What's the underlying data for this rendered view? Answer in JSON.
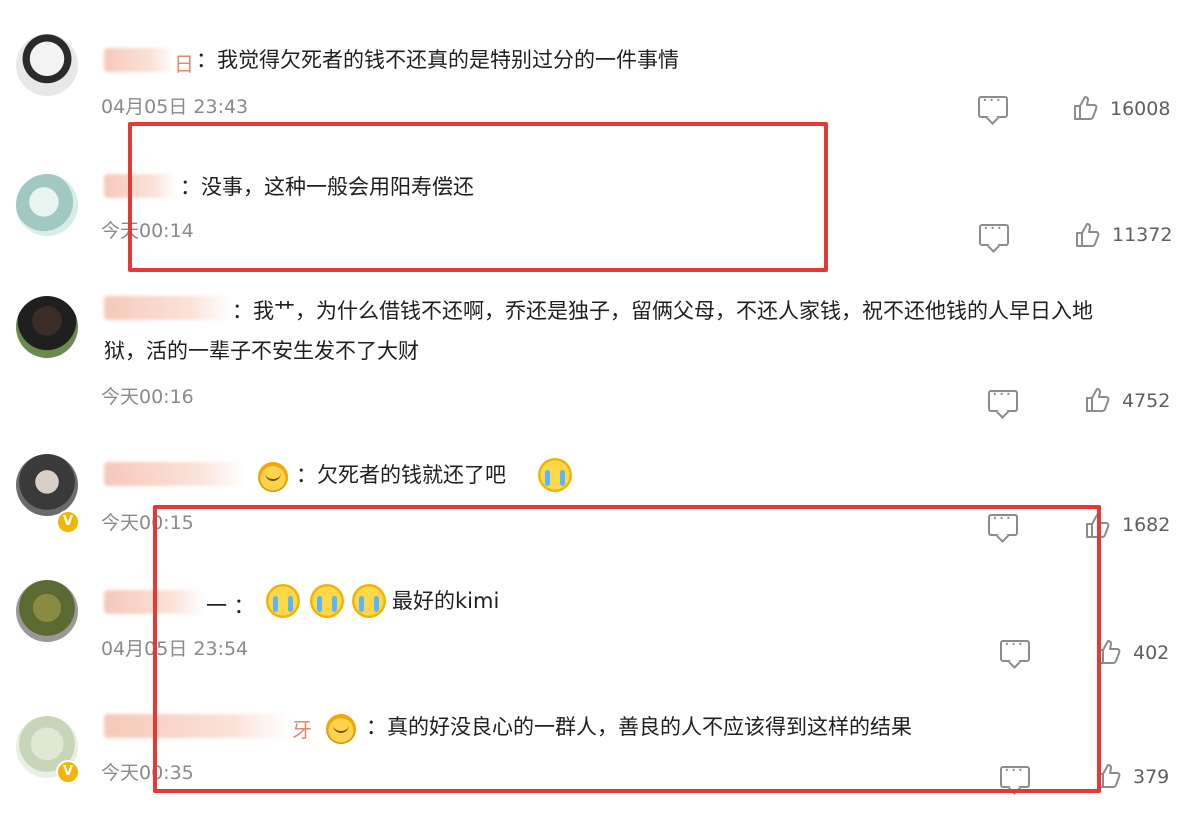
{
  "colors": {
    "highlight_box": "#e53935",
    "verified_badge": "#f5b400",
    "text": "#1f1f1f",
    "meta": "#8a8a8a"
  },
  "comments": [
    {
      "text": "：我觉得欠死者的钱不还真的是特别过分的一件事情",
      "username_partial": "日",
      "time": "04月05日 23:43",
      "likes": "16008",
      "comment_icon": "comment-icon",
      "like_icon": "thumbs-up-icon"
    },
    {
      "text": "：没事，这种一般会用阳寿偿还",
      "time": "今天00:14",
      "likes": "11372",
      "comment_icon": "comment-icon",
      "like_icon": "thumbs-up-icon"
    },
    {
      "text_line1": "：我艹，为什么借钱不还啊，乔还是独子，留俩父母，不还人家钱，祝不还他钱的人早日入地",
      "text_line2": "狱，活的一辈子不安生发不了大财",
      "time": "今天00:16",
      "likes": "4752",
      "comment_icon": "comment-icon",
      "like_icon": "thumbs-up-icon"
    },
    {
      "text": "：欠死者的钱就还了吧",
      "time": "今天00:15",
      "likes": "1682",
      "badge_icon": "fan-badge-emoji-icon",
      "trailing_icon": "crying-laughing-emoji-icon",
      "comment_icon": "comment-icon",
      "like_icon": "thumbs-up-icon",
      "verified": "V"
    },
    {
      "text": "最好的kimi",
      "username_partial": "一 ：",
      "time": "04月05日 23:54",
      "likes": "402",
      "emoji_icons": [
        "crying-emoji-icon",
        "crying-emoji-icon",
        "crying-emoji-icon"
      ],
      "comment_icon": "comment-icon",
      "like_icon": "thumbs-up-icon"
    },
    {
      "text": "：真的好没良心的一群人，善良的人不应该得到这样的结果",
      "username_partial": "牙",
      "time": "今天00:35",
      "likes": "379",
      "badge_icon": "fan-badge-emoji-icon",
      "comment_icon": "comment-icon",
      "like_icon": "thumbs-up-icon",
      "verified": "V"
    }
  ]
}
